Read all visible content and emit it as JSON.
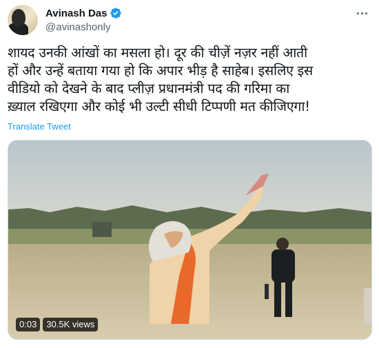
{
  "tweet": {
    "author": {
      "display_name": "Avinash Das",
      "handle": "@avinashonly",
      "verified": true
    },
    "lines": [
      "शायद उनकी आंखों का मसला हो। दूर की चीज़ें नज़र नहीं आती",
      "हों और उन्हें बताया गया हो कि अपार भीड़ है साहेब। इसलिए इस",
      "वीडियो को देखने के बाद प्लीज़ प्रधानमंत्री पद की गरिमा का",
      "ख़्याल रखिएगा और कोई भी उल्टी सीधी टिप्पणी मत कीजिएगा!"
    ],
    "translate_label": "Translate Tweet",
    "video": {
      "duration": "0:03",
      "views": "30.5K views"
    }
  },
  "colors": {
    "accent": "#1d9bf0",
    "text": "#0f1419",
    "secondary": "#536471",
    "verified": "#1d9bf0"
  },
  "icons": {
    "verified": "verified-badge-icon",
    "more": "more-dots-icon"
  }
}
